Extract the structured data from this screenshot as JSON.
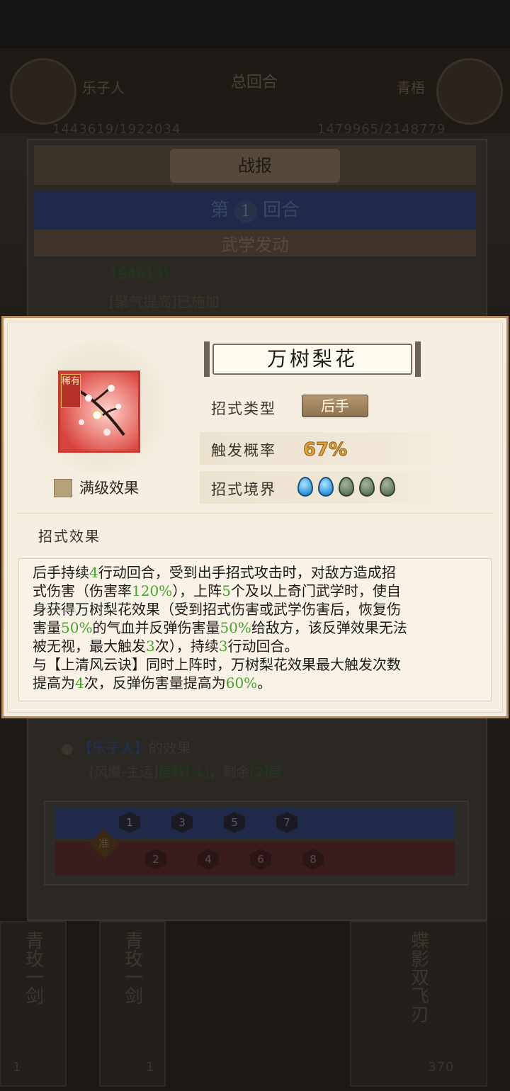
{
  "background": {
    "player_left": {
      "name": "乐子人",
      "hp": "1443619/1922034"
    },
    "player_right": {
      "name": "青梧",
      "hp": "1479965/2148779"
    },
    "total_rounds_label": "总回合",
    "report_title": "战报",
    "round_prefix": "第",
    "round_number": "1",
    "round_suffix": "回合",
    "section_title": "武学发动",
    "log_green_value": "194613)",
    "log_line": "[聚气提高]已施加",
    "effect_owner_prefix": "",
    "effect_owner_name": "【乐子人】",
    "effect_owner_suffix": "的效果",
    "effect_detail_prefix": "[风魔-主运]",
    "effect_detail_green": "层数[-1]",
    "effect_detail_mid": "，剩余",
    "effect_detail_green2": "[2]层",
    "ready_label": "准",
    "track_blue": [
      "1",
      "3",
      "5",
      "7"
    ],
    "track_red": [
      "2",
      "4",
      "6",
      "8"
    ],
    "bottom_cards": [
      "青玫一剑",
      "青玫一剑",
      "蝶影双飞刃"
    ],
    "card_levels": [
      "1",
      "1",
      "370"
    ]
  },
  "popup": {
    "rarity_tag": "稀有",
    "max_level_label": "满级效果",
    "skill_name": "万树梨花",
    "type_label": "招式类型",
    "type_value": "后手",
    "prob_label": "触发概率",
    "prob_value": "67%",
    "realm_label": "招式境界",
    "realm_filled": 2,
    "realm_total": 5,
    "effect_header": "招式效果",
    "desc": {
      "l1a": "后手持续",
      "l1b": "4",
      "l1c": "行动回合，受到出手招式攻击时，对敌方造成招",
      "l2a": "式伤害（伤害率",
      "l2b": "120%",
      "l2c": "），上阵",
      "l2d": "5",
      "l2e": "个及以上奇门武学时，使自",
      "l3": "身获得万树梨花效果（受到招式伤害或武学伤害后，恢复伤",
      "l4a": "害量",
      "l4b": "50%",
      "l4c": "的气血并反弹伤害量",
      "l4d": "50%",
      "l4e": "给敌方，该反弹效果无法",
      "l5a": "被无视，最大触发",
      "l5b": "3",
      "l5c": "次），持续",
      "l5d": "3",
      "l5e": "行动回合。",
      "l6": "与【上清风云诀】同时上阵时，万树梨花效果最大触发次数",
      "l7a": "提高为",
      "l7b": "4",
      "l7c": "次，反弹伤害量提高为",
      "l7d": "60%",
      "l7e": "。"
    }
  },
  "colors": {
    "accent_green": "#48a22e",
    "popup_bg": "#f6efe1",
    "popup_border": "#b88a5a",
    "prob_gold": "#e1a33a"
  }
}
